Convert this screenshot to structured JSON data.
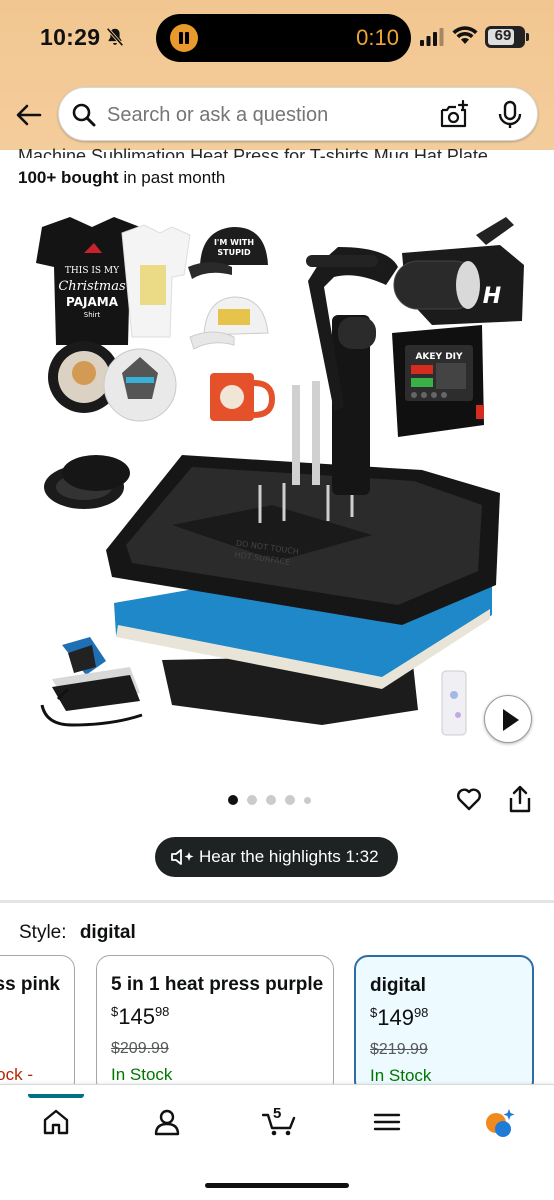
{
  "status_bar": {
    "time": "10:29",
    "timer": "0:10",
    "battery": "69",
    "icons": [
      "bell-muted-icon",
      "pause-indicator-icon",
      "signal-icon",
      "wifi-icon",
      "battery-icon"
    ]
  },
  "search": {
    "placeholder": "Search or ask a question",
    "icons": [
      "back-arrow-icon",
      "search-icon",
      "camera-icon",
      "mic-icon"
    ]
  },
  "product": {
    "title_fragment": "Machine Sublimation Heat Press for T-shirts Mug Hat Plate",
    "bought_count": "100+ bought",
    "bought_suffix": " in past month"
  },
  "gallery": {
    "image_texts": {
      "tshirt": "THIS IS MY Christmas PAJAMA Shirt",
      "cap": "I'M WITH STUPID",
      "brand": "AKEY DIY",
      "plate_warning": "DO NOT TOUCH HOT SURFACE"
    },
    "dots": {
      "total": 5,
      "active_index": 0
    },
    "icons": [
      "play-icon",
      "heart-icon",
      "share-icon"
    ]
  },
  "highlights": {
    "label": "Hear the highlights 1:32",
    "icon": "speaker-sparkle-icon"
  },
  "style": {
    "label": "Style:",
    "selected": "digital",
    "options": [
      {
        "name": "ss pink",
        "price": "",
        "list_price": "",
        "stock": "ock -"
      },
      {
        "name": "5 in 1 heat press purple",
        "price_currency": "$",
        "price_whole": "145",
        "price_cents": "98",
        "list_price": "$209.99",
        "stock": "In Stock"
      },
      {
        "name": "digital",
        "price_currency": "$",
        "price_whole": "149",
        "price_cents": "98",
        "list_price": "$219.99",
        "stock": "In Stock"
      }
    ]
  },
  "bottom_nav": {
    "cart_count": "5",
    "items": [
      "home-icon",
      "account-icon",
      "cart-icon",
      "menu-icon",
      "ai-assistant-icon"
    ]
  },
  "colors": {
    "header_bg": "#f3c894",
    "selected_card_border": "#2e6da4",
    "selected_card_bg": "#edfaff",
    "in_stock": "#007600",
    "active_nav": "#007185",
    "pill_bg": "#1f2222"
  }
}
